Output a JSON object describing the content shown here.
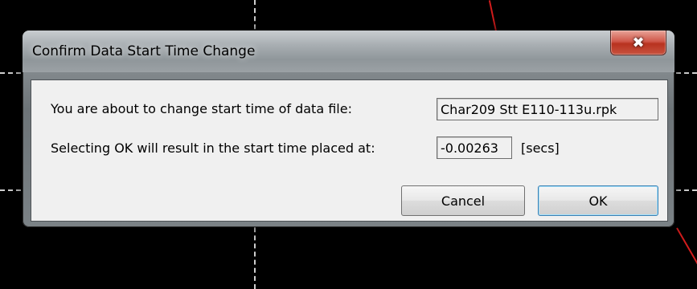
{
  "dialog": {
    "title": "Confirm Data Start Time Change",
    "close_label": "✖",
    "line1_label": "You are about to change start time of data file:",
    "file_name": "Char209 Stt E110-113u.rpk",
    "line2_label": "Selecting OK will result in the start time placed at:",
    "start_time_value": "-0.00263",
    "units_label": "[secs]",
    "cancel_label": "Cancel",
    "ok_label": "OK"
  },
  "colors": {
    "close_button": "#c8533f",
    "background": "#000000",
    "trace": "#d21c1c"
  }
}
